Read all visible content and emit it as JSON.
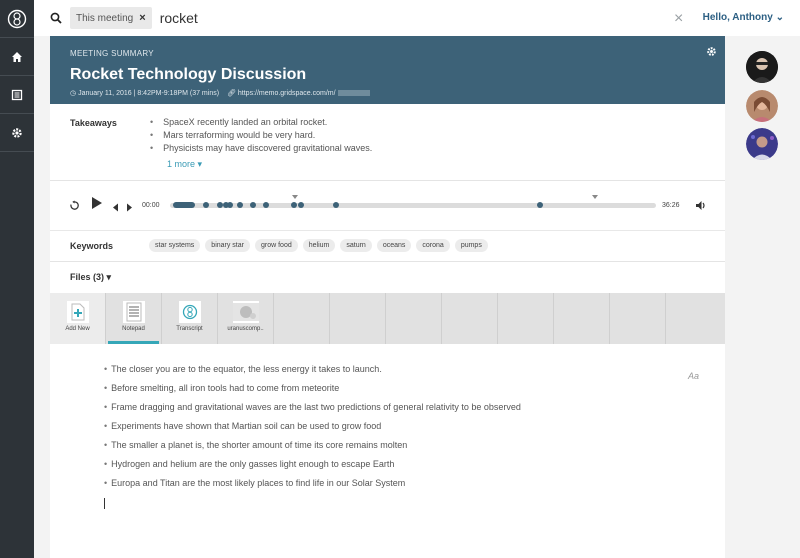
{
  "search": {
    "scope_chip": "This meeting",
    "query": "rocket"
  },
  "user": {
    "greeting": "Hello, Anthony"
  },
  "meeting": {
    "label": "MEETING SUMMARY",
    "title": "Rocket Technology Discussion",
    "datetime": "January 11, 2016 | 8:42PM-9:18PM (37 mins)",
    "url": "https://memo.gridspace.com/m/"
  },
  "takeaways": {
    "label": "Takeaways",
    "items": [
      "SpaceX recently landed an orbital rocket.",
      "Mars terraforming would be very hard.",
      "Physicists may have discovered gravitational waves."
    ],
    "more": "1 more"
  },
  "player": {
    "current": "00:00",
    "duration": "36:26"
  },
  "keywords": {
    "label": "Keywords",
    "tags": [
      "star systems",
      "binary star",
      "grow food",
      "helium",
      "saturn",
      "oceans",
      "corona",
      "pumps"
    ]
  },
  "files": {
    "label": "Files (3)",
    "items": [
      {
        "caption": "Add New",
        "icon": "add-document-icon"
      },
      {
        "caption": "Notepad",
        "icon": "notepad-icon"
      },
      {
        "caption": "Transcript",
        "icon": "transcript-icon"
      },
      {
        "caption": "uranuscomp..",
        "icon": "image-icon"
      }
    ]
  },
  "notes": {
    "font_toggle": "Aa",
    "lines": [
      "The closer you are to the equator, the less energy it takes to launch.",
      "Before smelting, all iron tools had to come from meteorite",
      "Frame dragging and gravitational waves are the last two predictions of general relativity to be observed",
      "Experiments have shown that Martian soil can be used to grow food",
      "The smaller a planet is, the shorter amount of time its core remains molten",
      "Hydrogen and helium are the only gasses light enough to escape Earth",
      "Europa and Titan are the most likely places to find life in our Solar System"
    ]
  },
  "colors": {
    "header_bg": "#3d6278",
    "accent": "#35a7b8",
    "nav_bg": "#2d3338"
  }
}
